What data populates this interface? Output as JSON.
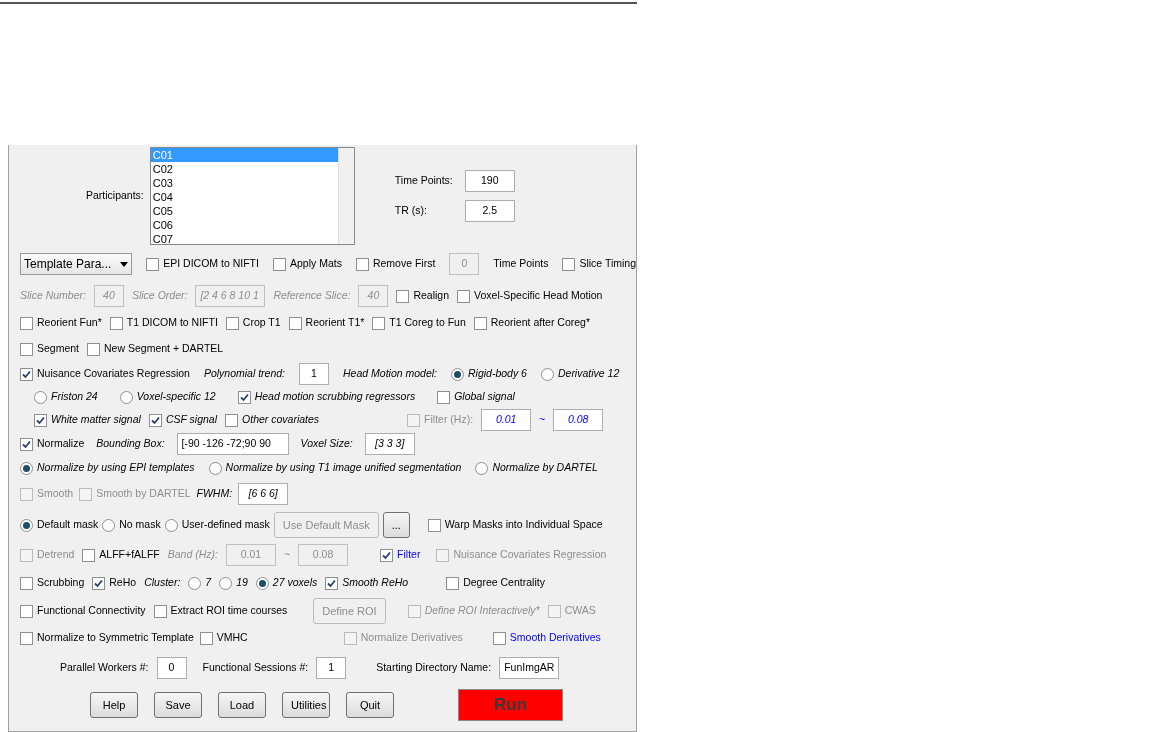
{
  "participants": {
    "label": "Participants:",
    "items": [
      {
        "text": "C01",
        "selected": true
      },
      {
        "text": "C02",
        "selected": false
      },
      {
        "text": "C03",
        "selected": false
      },
      {
        "text": "C04",
        "selected": false
      },
      {
        "text": "C05",
        "selected": false
      },
      {
        "text": "C06",
        "selected": false
      },
      {
        "text": "C07",
        "selected": false
      }
    ]
  },
  "time_points": {
    "label": "Time Points:",
    "value": "190"
  },
  "tr": {
    "label": "TR (s):",
    "value": "2.5"
  },
  "rows": [
    [
      {
        "kind": "dropdown",
        "text": "Template Para..."
      },
      {
        "kind": "checkbox",
        "text": "EPI DICOM to NIFTI",
        "checked": false
      },
      {
        "kind": "checkbox",
        "text": "Apply Mats",
        "checked": false
      },
      {
        "kind": "checkbox",
        "text": "Remove First",
        "checked": false
      },
      {
        "kind": "field",
        "text": "0",
        "disabled": true
      },
      {
        "kind": "label",
        "text": "Time Points"
      },
      {
        "kind": "checkbox",
        "text": "Slice Timing",
        "checked": false
      }
    ],
    [
      {
        "kind": "label",
        "text": "Slice Number:",
        "disabled": true,
        "italic": true
      },
      {
        "kind": "field",
        "text": "40",
        "disabled": true,
        "italic": true
      },
      {
        "kind": "label",
        "text": "Slice Order:",
        "disabled": true,
        "italic": true
      },
      {
        "kind": "field",
        "text": "[2 4 6 8 10 1",
        "disabled": true,
        "italic": true
      },
      {
        "kind": "label",
        "text": "Reference Slice:",
        "disabled": true,
        "italic": true
      },
      {
        "kind": "field",
        "text": "40",
        "disabled": true,
        "italic": true
      },
      {
        "kind": "checkbox",
        "text": "Realign",
        "checked": false
      },
      {
        "kind": "checkbox",
        "text": "Voxel-Specific Head Motion",
        "checked": false
      }
    ],
    [
      {
        "kind": "checkbox",
        "text": "Reorient Fun*",
        "checked": false
      },
      {
        "kind": "checkbox",
        "text": "T1 DICOM to NIFTI",
        "checked": false
      },
      {
        "kind": "checkbox",
        "text": "Crop T1",
        "checked": false
      },
      {
        "kind": "checkbox",
        "text": "Reorient T1*",
        "checked": false
      },
      {
        "kind": "checkbox",
        "text": "T1 Coreg to Fun",
        "checked": false
      },
      {
        "kind": "checkbox",
        "text": "Reorient after Coreg*",
        "checked": false
      }
    ],
    [
      {
        "kind": "checkbox",
        "text": "Segment",
        "checked": false
      },
      {
        "kind": "checkbox",
        "text": "New Segment + DARTEL",
        "checked": false
      }
    ],
    [
      {
        "kind": "checkbox",
        "text": "Nuisance Covariates Regression",
        "checked": true
      },
      {
        "kind": "label",
        "text": "Polynomial trend:",
        "italic": true
      },
      {
        "kind": "field",
        "text": "1"
      },
      {
        "kind": "label",
        "text": "Head Motion model:",
        "italic": true
      },
      {
        "kind": "radio",
        "text": "Rigid-body 6",
        "selected": true,
        "italic": true
      },
      {
        "kind": "radio",
        "text": "Derivative 12",
        "selected": false,
        "italic": true
      }
    ],
    [
      {
        "kind": "radio",
        "text": "Friston 24",
        "selected": false,
        "italic": true
      },
      {
        "kind": "radio",
        "text": "Voxel-specific 12",
        "selected": false,
        "italic": true
      },
      {
        "kind": "checkbox",
        "text": "Head motion scrubbing regressors",
        "checked": true,
        "italic": true
      },
      {
        "kind": "checkbox",
        "text": "Global signal",
        "checked": false,
        "italic": true
      }
    ],
    [
      {
        "kind": "checkbox",
        "text": "White matter signal",
        "checked": true,
        "italic": true
      },
      {
        "kind": "checkbox",
        "text": "CSF signal",
        "checked": true,
        "italic": true
      },
      {
        "kind": "checkbox",
        "text": "Other covariates",
        "checked": false,
        "italic": true
      },
      {
        "kind": "checkbox",
        "text": "Filter (Hz):",
        "checked": false,
        "disabled": true
      },
      {
        "kind": "field",
        "text": "0.01",
        "italic": true,
        "blue": true
      },
      {
        "kind": "label",
        "text": "~",
        "blue": true
      },
      {
        "kind": "field",
        "text": "0.08",
        "italic": true,
        "blue": true
      }
    ],
    [
      {
        "kind": "checkbox",
        "text": "Normalize",
        "checked": true
      },
      {
        "kind": "label",
        "text": "Bounding Box:",
        "italic": true
      },
      {
        "kind": "field",
        "text": "[-90 -126 -72;90 90"
      },
      {
        "kind": "label",
        "text": "Voxel Size:",
        "italic": true
      },
      {
        "kind": "field",
        "text": "[3 3 3]",
        "italic": true
      }
    ],
    [
      {
        "kind": "radio",
        "text": "Normalize by using EPI templates",
        "selected": true,
        "italic": true
      },
      {
        "kind": "radio",
        "text": "Normalize by using T1 image unified segmentation",
        "selected": false,
        "italic": true
      },
      {
        "kind": "radio",
        "text": "Normalize by DARTEL",
        "selected": false,
        "italic": true
      }
    ],
    [
      {
        "kind": "checkbox",
        "text": "Smooth",
        "checked": false,
        "disabled": true
      },
      {
        "kind": "checkbox",
        "text": "Smooth by DARTEL",
        "checked": false,
        "disabled": true
      },
      {
        "kind": "label",
        "text": "FWHM:",
        "italic": true
      },
      {
        "kind": "field",
        "text": "[6 6 6]",
        "italic": true
      }
    ],
    [
      {
        "kind": "radio",
        "text": "Default mask",
        "selected": true
      },
      {
        "kind": "radio",
        "text": "No mask",
        "selected": false
      },
      {
        "kind": "radio",
        "text": "User-defined mask",
        "selected": false
      },
      {
        "kind": "button",
        "text": "Use Default Mask",
        "disabled": true
      },
      {
        "kind": "button",
        "text": "...",
        "disabled": false
      },
      {
        "kind": "checkbox",
        "text": "Warp Masks into Individual Space",
        "checked": false
      }
    ],
    [
      {
        "kind": "checkbox",
        "text": "Detrend",
        "checked": false,
        "disabled": true
      },
      {
        "kind": "checkbox",
        "text": "ALFF+fALFF",
        "checked": false
      },
      {
        "kind": "label",
        "text": "Band (Hz):",
        "disabled": true,
        "italic": true
      },
      {
        "kind": "field",
        "text": "0.01",
        "disabled": true
      },
      {
        "kind": "label",
        "text": "~",
        "disabled": true
      },
      {
        "kind": "field",
        "text": "0.08",
        "disabled": true
      },
      {
        "kind": "checkbox",
        "text": "Filter",
        "checked": true,
        "blue": true
      },
      {
        "kind": "checkbox",
        "text": "Nuisance Covariates Regression",
        "checked": false,
        "disabled": true
      }
    ],
    [
      {
        "kind": "checkbox",
        "text": "Scrubbing",
        "checked": false
      },
      {
        "kind": "checkbox",
        "text": "ReHo",
        "checked": true
      },
      {
        "kind": "label",
        "text": "Cluster:",
        "italic": true
      },
      {
        "kind": "radio",
        "text": "7",
        "selected": false,
        "italic": true
      },
      {
        "kind": "radio",
        "text": "19",
        "selected": false,
        "italic": true
      },
      {
        "kind": "radio",
        "text": "27 voxels",
        "selected": true,
        "italic": true
      },
      {
        "kind": "checkbox",
        "text": "Smooth ReHo",
        "checked": true,
        "italic": true
      },
      {
        "kind": "checkbox",
        "text": "Degree Centrality",
        "checked": false
      }
    ],
    [
      {
        "kind": "checkbox",
        "text": "Functional Connectivity",
        "checked": false
      },
      {
        "kind": "checkbox",
        "text": "Extract ROI time courses",
        "checked": false
      },
      {
        "kind": "button",
        "text": "Define ROI",
        "disabled": true
      },
      {
        "kind": "checkbox",
        "text": "Define ROI Interactively*",
        "checked": false,
        "disabled": true,
        "italic": true
      },
      {
        "kind": "checkbox",
        "text": "CWAS",
        "checked": false,
        "disabled": true
      }
    ],
    [
      {
        "kind": "checkbox",
        "text": "Normalize to Symmetric Template",
        "checked": false
      },
      {
        "kind": "checkbox",
        "text": "VMHC",
        "checked": false
      },
      {
        "kind": "checkbox",
        "text": "Normalize Derivatives",
        "checked": false,
        "disabled": true
      },
      {
        "kind": "checkbox",
        "text": "Smooth Derivatives",
        "checked": false,
        "blue": true
      }
    ],
    [
      {
        "kind": "label",
        "text": "Parallel Workers #:"
      },
      {
        "kind": "field",
        "text": "0"
      },
      {
        "kind": "label",
        "text": "Functional Sessions #:"
      },
      {
        "kind": "field",
        "text": "1"
      },
      {
        "kind": "label",
        "text": "Starting Directory Name:"
      },
      {
        "kind": "field",
        "text": "FunImgAR"
      }
    ],
    [
      {
        "kind": "button",
        "text": "Help"
      },
      {
        "kind": "button",
        "text": "Save"
      },
      {
        "kind": "button",
        "text": "Load"
      },
      {
        "kind": "button",
        "text": "Utilities"
      },
      {
        "kind": "button",
        "text": "Quit"
      },
      {
        "kind": "run",
        "text": "Run"
      }
    ]
  ]
}
